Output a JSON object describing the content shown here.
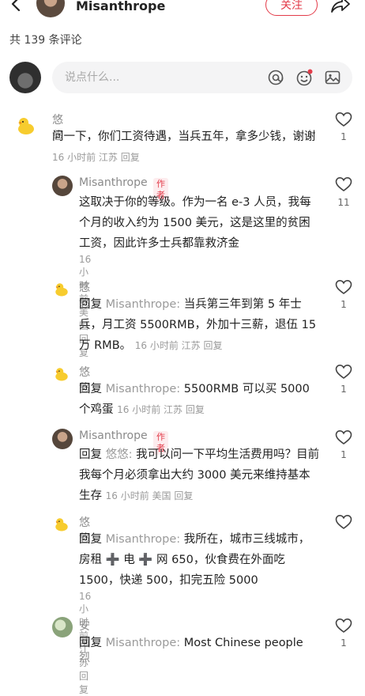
{
  "header": {
    "username": "Misanthrope",
    "follow_label": "关注"
  },
  "comment_count": "共 139 条评论",
  "input": {
    "placeholder": "说点什么..."
  },
  "author_tag": "作者",
  "comments": [
    {
      "user": "悠悠",
      "avatar": "duck-avatar",
      "text": "问一下，你们工资待遇，当兵五年，拿多少钱，谢谢",
      "meta": "16 小时前 江苏 回复",
      "likes": "1"
    },
    {
      "user": "Misanthrope",
      "avatar": "user-avatar",
      "is_author": true,
      "text": "这取决于你的等级。作为一名 e-3 人员，我每个月的收入约为 1500 美元，这是这里的贫困工资，因此许多士兵都靠救济金",
      "meta": "16 小时前 美国 回复",
      "likes": "11"
    },
    {
      "user": "悠悠",
      "avatar": "duck-avatar",
      "reply_prefix": "回复",
      "reply_to": "Misanthrope:",
      "text": "当兵第三年到第 5 年士兵，月工资 5500RMB，外加十三薪，退伍 15 万 RMB。",
      "meta": "16 小时前 江苏 回复",
      "likes": "1"
    },
    {
      "user": "悠悠",
      "avatar": "duck-avatar",
      "reply_prefix": "回复",
      "reply_to": "Misanthrope:",
      "text": "5500RMB 可以买 5000 个鸡蛋",
      "meta": "16 小时前 江苏 回复",
      "likes": "1"
    },
    {
      "user": "Misanthrope",
      "avatar": "user-avatar",
      "is_author": true,
      "reply_prefix": "回复",
      "reply_to": "悠悠:",
      "text": "我可以问一下平均生活费用吗？目前我每个月必须拿出大约 3000 美元来维持基本生存",
      "meta": "16 小时前 美国 回复",
      "likes": "1"
    },
    {
      "user": "悠悠",
      "avatar": "duck-avatar",
      "reply_prefix": "回复",
      "reply_to": "Misanthrope:",
      "text": "我所在，城市三线城市，房租 ➕ 电 ➕ 网 650，伙食费在外面吃 1500，快递 500，扣完五险 5000",
      "meta": "16 小时前 江苏 回复",
      "likes": ""
    },
    {
      "user": "安晴烈",
      "avatar": "plant-avatar",
      "reply_prefix": "回复",
      "reply_to": "Misanthrope:",
      "text": "Most Chinese people",
      "meta": "",
      "likes": "1"
    }
  ]
}
